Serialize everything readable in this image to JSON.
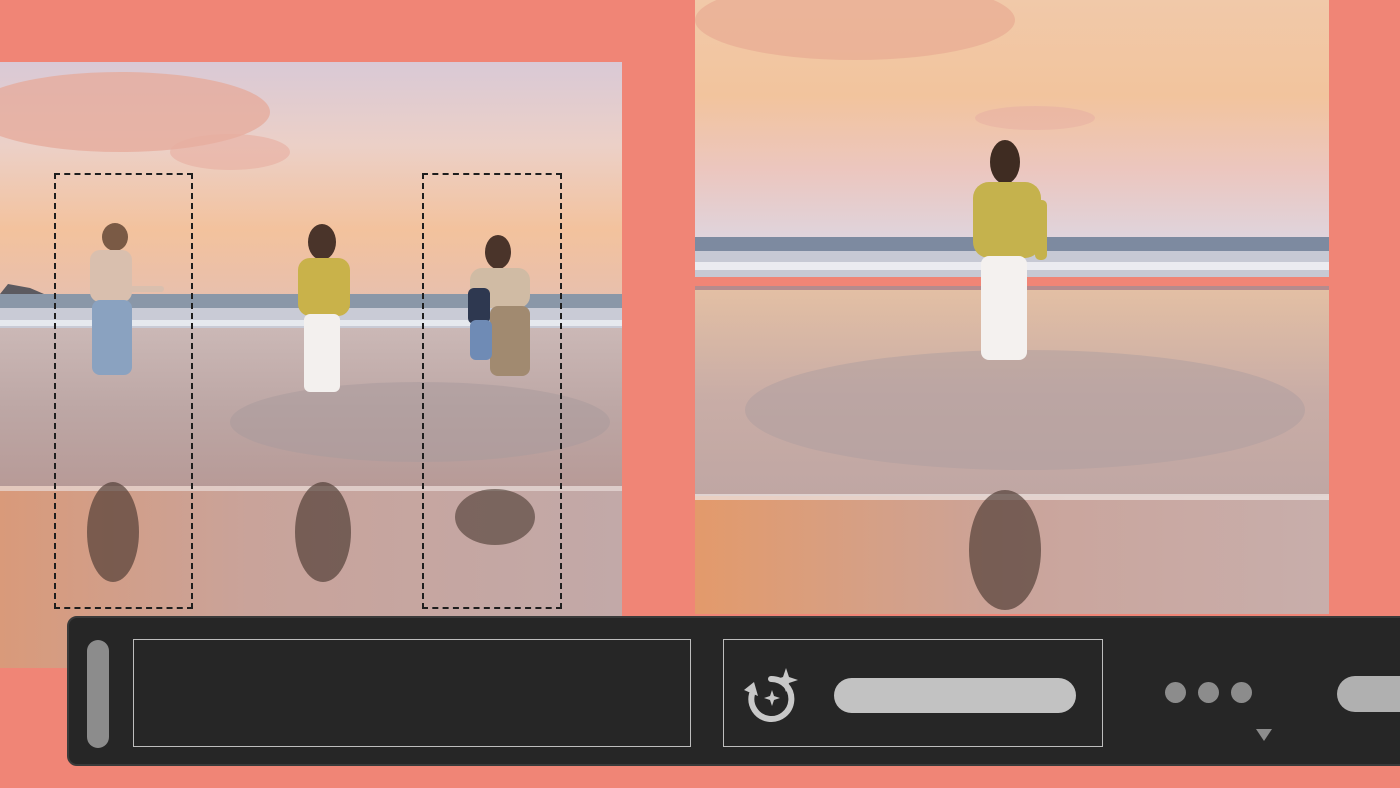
{
  "before_image": {
    "description_icon": "beach-photo-three-people",
    "selection_count": 2
  },
  "after_image": {
    "description_icon": "beach-photo-one-person"
  },
  "toolbar": {
    "prompt_value": "",
    "generate_label": "",
    "more_icon": "ellipsis-icon",
    "regenerate_icon": "regenerate-sparkle-icon",
    "colors": {
      "bar": "#262626",
      "pill": "#c2c2c2",
      "accent": "#f08576"
    }
  }
}
